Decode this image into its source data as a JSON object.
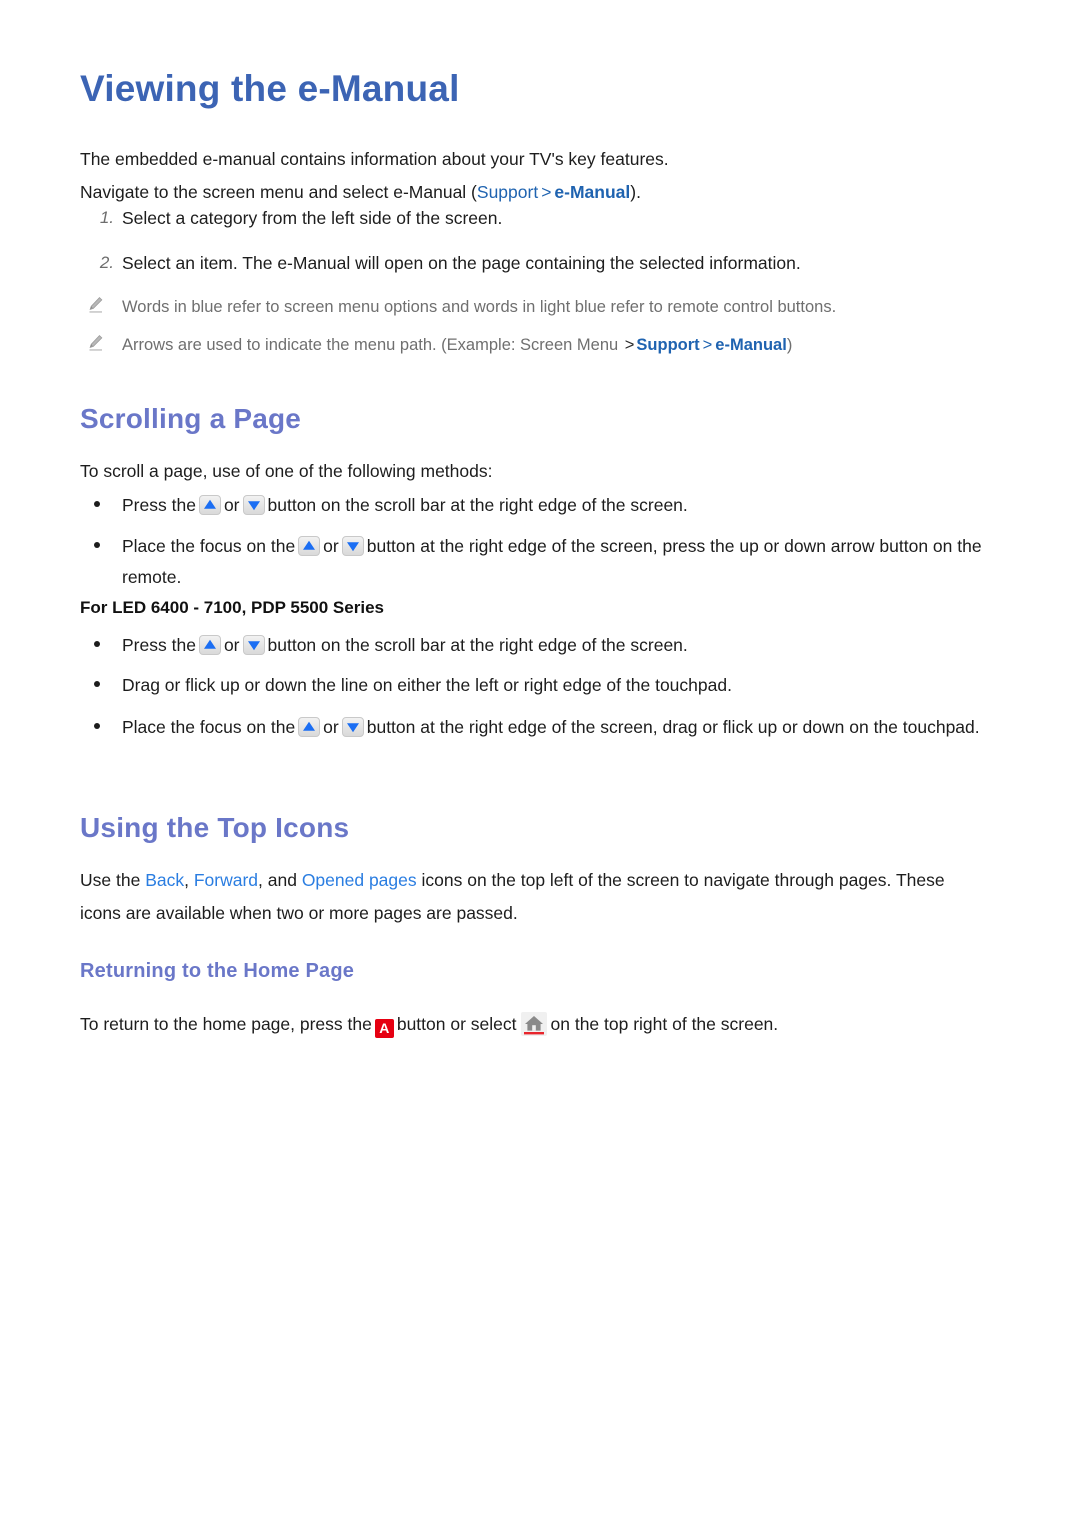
{
  "page": {
    "title": "Viewing the e-Manual"
  },
  "intro": {
    "line1": "The embedded e-manual contains information about your TV's key features.",
    "line2_prefix": "Navigate to the screen menu and select e-Manual (",
    "line2_menu1": "Support",
    "line2_sep": ">",
    "line2_menu2": "e-Manual",
    "line2_suffix": ")."
  },
  "steps": [
    {
      "marker": "1.",
      "text": "Select a category from the left side of the screen."
    },
    {
      "marker": "2.",
      "text": "Select an item. The e-Manual will open on the page containing the selected information."
    }
  ],
  "notes": [
    {
      "icon": "pencil-icon",
      "text": "Words in blue refer to screen menu options and words in light blue refer to remote control buttons."
    },
    {
      "icon": "pencil-icon",
      "prefix": "Arrows are used to indicate the menu path. (Example: Screen Menu ",
      "sep": ">",
      "menu1": "Support",
      "sep2": ">",
      "menu2": "e-Manual",
      "suffix": ")"
    }
  ],
  "scrolling": {
    "heading": "Scrolling a Page",
    "intro": "To scroll a page, use of one of the following methods:",
    "bullets": [
      {
        "part1": "Press the",
        "icon1": "arrow-up-button-icon",
        "mid": "or",
        "icon2": "arrow-down-button-icon",
        "part2": "button on the scroll bar at the right edge of the screen."
      },
      {
        "part1": "Place the focus on the",
        "icon1": "arrow-up-button-icon",
        "mid": "or",
        "icon2": "arrow-down-button-icon",
        "part2": "button at the right edge of the screen, press the up or down arrow button on the remote."
      }
    ],
    "series_label": "For LED 6400 - 7100, PDP 5500 Series",
    "series_bullets": [
      {
        "part1": "Press the",
        "icon1": "arrow-up-button-icon",
        "mid": "or",
        "icon2": "arrow-down-button-icon",
        "part2": "button on the scroll bar at the right edge of the screen."
      },
      {
        "plain": "Drag or flick up or down the line on either the left or right edge of the touchpad."
      },
      {
        "part1": "Place the focus on the",
        "icon1": "arrow-up-button-icon",
        "mid": "or",
        "icon2": "arrow-down-button-icon",
        "part2": "button at the right edge of the screen, drag or flick up or down on the touchpad."
      }
    ]
  },
  "top_icons": {
    "heading": "Using the Top Icons",
    "body_prefix": "Use the ",
    "link_back": "Back",
    "comma1": ", ",
    "link_forward": "Forward",
    "comma2": ", and ",
    "link_opened": "Opened pages",
    "body_suffix": " icons on the top left of the screen to navigate through pages. These icons are available when two or more pages are passed."
  },
  "home": {
    "heading": "Returning to the Home Page",
    "line_prefix": "To return to the home page, press the",
    "a_button": "A",
    "line_mid": "button or select",
    "home_icon": "home-icon",
    "line_suffix": "on the top right of the screen."
  },
  "colors": {
    "title_blue": "#3c64b4",
    "heading_purple": "#6a77c8",
    "menu_blue": "#1f63b0",
    "light_blue": "#2a7de1",
    "note_gray": "#6f6f6f",
    "red_button": "#e60012",
    "triangle_blue": "#1b6ef3"
  }
}
